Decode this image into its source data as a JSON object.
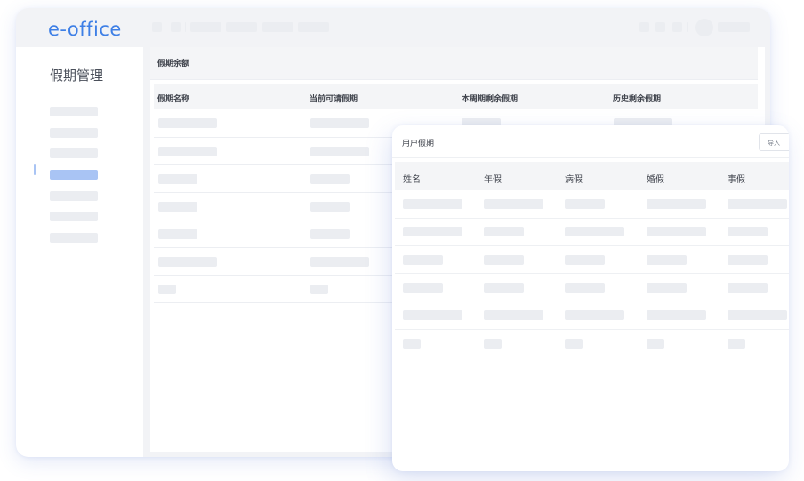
{
  "app": {
    "logo_text": "e-office"
  },
  "sidebar": {
    "title": "假期管理",
    "active_index": 3
  },
  "balance": {
    "title": "假期余额",
    "columns": [
      "假期名称",
      "当前可请假期",
      "本周期剩余假期",
      "历史剩余假期"
    ]
  },
  "user_panel": {
    "title": "用户假期",
    "import_label": "导入",
    "columns": [
      "姓名",
      "年假",
      "病假",
      "婚假",
      "事假"
    ]
  },
  "colors": {
    "brand": "#3e7fe6",
    "active_nav": "#a9c4f4",
    "placeholder": "#ebedf1"
  }
}
